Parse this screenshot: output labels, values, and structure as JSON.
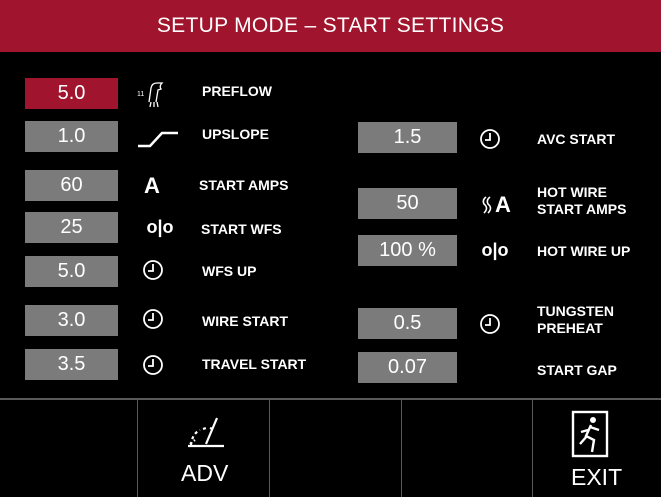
{
  "header": {
    "title": "SETUP MODE –  START SETTINGS"
  },
  "left_params": [
    {
      "value": "5.0",
      "label": "PREFLOW",
      "icon": "preflow-icon",
      "active": true
    },
    {
      "value": "1.0",
      "label": "UPSLOPE",
      "icon": "upslope-icon"
    },
    {
      "value": "60",
      "label": "START AMPS",
      "icon": "amps-icon",
      "icon_text": "A"
    },
    {
      "value": "25",
      "label": "START WFS",
      "icon": "wire-feed-icon",
      "icon_text": "o|o"
    },
    {
      "value": "5.0",
      "label": "WFS UP",
      "icon": "clock-icon"
    },
    {
      "value": "3.0",
      "label": "WIRE START",
      "icon": "clock-icon"
    },
    {
      "value": "3.5",
      "label": "TRAVEL START",
      "icon": "clock-icon"
    }
  ],
  "right_params": [
    {
      "value": "1.5",
      "label": "AVC START",
      "icon": "clock-icon"
    },
    {
      "value": "50",
      "label_line1": "HOT WIRE",
      "label_line2": "START AMPS",
      "icon": "hot-wire-amps-icon",
      "icon_text": "A"
    },
    {
      "value": "100 %",
      "label": "HOT WIRE UP",
      "icon": "wire-feed-icon",
      "icon_text": "o|o"
    },
    {
      "value": "0.5",
      "label_line1": "TUNGSTEN",
      "label_line2": "PREHEAT",
      "icon": "clock-icon"
    },
    {
      "value": "0.07",
      "label": "START GAP"
    }
  ],
  "bottom": {
    "adv_label": "ADV",
    "adv_icon": "advanced-gauge-icon",
    "exit_label": "EXIT",
    "exit_icon": "exit-door-icon"
  },
  "colors": {
    "accent": "#a0152d",
    "value_box": "#7b7b7b",
    "background": "#000000"
  }
}
